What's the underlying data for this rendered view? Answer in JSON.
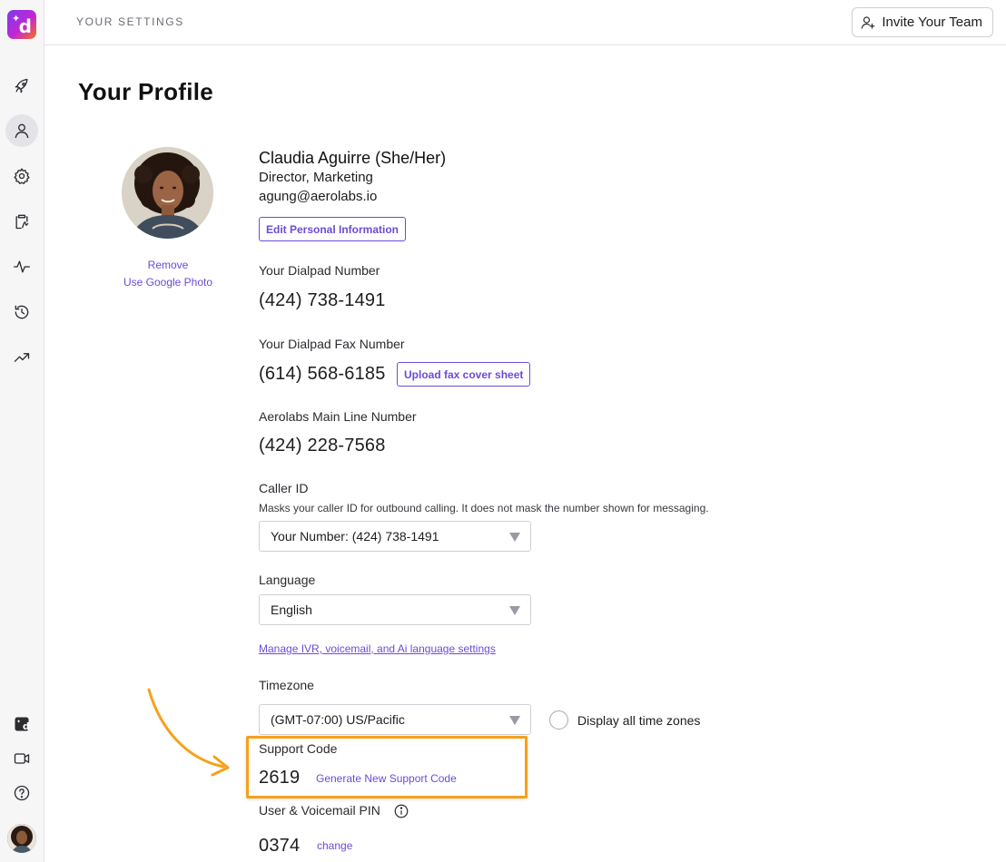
{
  "header": {
    "breadcrumb": "YOUR SETTINGS",
    "invite_label": "Invite Your Team"
  },
  "page": {
    "title": "Your Profile"
  },
  "profile": {
    "name": "Claudia Aguirre (She/Her)",
    "role": "Director, Marketing",
    "email": "agung@aerolabs.io",
    "edit_label": "Edit Personal Information",
    "remove_label": "Remove",
    "google_photo_label": "Use Google Photo"
  },
  "numbers": {
    "dialpad_label": "Your Dialpad Number",
    "dialpad_value": "(424) 738-1491",
    "fax_label": "Your Dialpad Fax Number",
    "fax_value": "(614) 568-6185",
    "fax_upload_label": "Upload fax cover sheet",
    "main_line_label": "Aerolabs Main Line Number",
    "main_line_value": "(424) 228-7568"
  },
  "caller_id": {
    "label": "Caller ID",
    "helper": "Masks your caller ID for outbound calling. It does not mask the number shown for messaging.",
    "selected": "Your Number: (424) 738-1491"
  },
  "language": {
    "label": "Language",
    "selected": "English",
    "manage_link": "Manage IVR, voicemail, and Ai language settings"
  },
  "timezone": {
    "label": "Timezone",
    "selected": "(GMT-07:00) US/Pacific",
    "display_all_label": "Display all time zones"
  },
  "support": {
    "label": "Support Code",
    "code": "2619",
    "generate_label": "Generate New Support Code"
  },
  "pin": {
    "label": "User & Voicemail PIN",
    "value": "0374",
    "change_label": "change"
  },
  "colors": {
    "accent": "#6d4bd6",
    "highlight": "#f5a11c"
  },
  "icons": {
    "rail": [
      "rocket-icon",
      "person-icon",
      "gear-icon",
      "clipboard-icon",
      "activity-icon",
      "history-icon",
      "trending-icon",
      "dialpad-ai-icon",
      "video-icon",
      "help-icon"
    ]
  }
}
